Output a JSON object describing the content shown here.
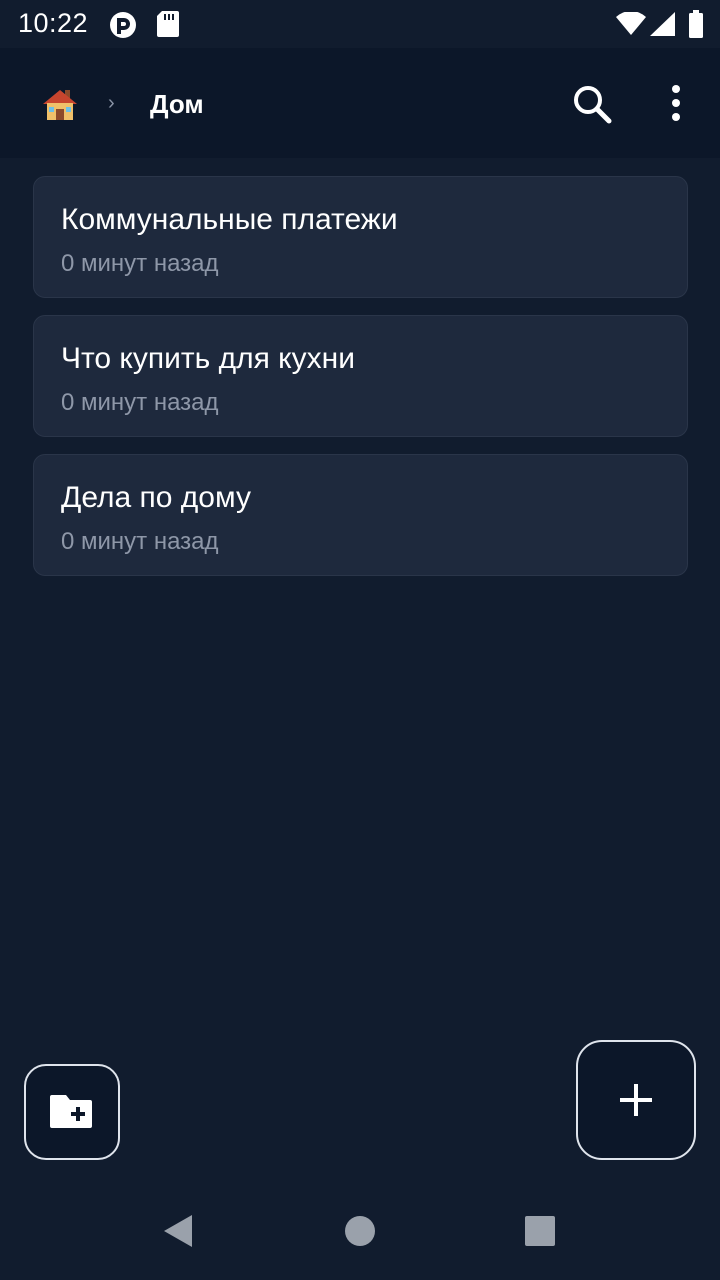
{
  "status_bar": {
    "time": "10:22",
    "icons": [
      "app-notification-icon",
      "sd-card-icon",
      "wifi-icon",
      "cellular-signal-icon",
      "battery-icon"
    ]
  },
  "app_bar": {
    "home_icon": "house-emoji-icon",
    "breadcrumb_separator": "›",
    "title": "Дом",
    "actions": [
      "search-icon",
      "more-vert-icon"
    ]
  },
  "notes": [
    {
      "title": "Коммунальные платежи",
      "time": "0 минут назад"
    },
    {
      "title": "Что купить для кухни",
      "time": "0 минут назад"
    },
    {
      "title": "Дела по дому",
      "time": "0 минут назад"
    }
  ],
  "fabs": {
    "new_folder_icon": "create-folder-icon",
    "add_icon": "plus-icon"
  },
  "nav_bar": {
    "icons": [
      "back-triangle-icon",
      "home-circle-icon",
      "recents-square-icon"
    ]
  },
  "colors": {
    "background": "#111c2e",
    "app_bar": "#0c1729",
    "card": "#1e293d",
    "card_border": "#2a3549",
    "secondary_text": "#8e97a8",
    "fab_border": "#dfe4ec",
    "nav_icons": "#9aa1ab"
  }
}
